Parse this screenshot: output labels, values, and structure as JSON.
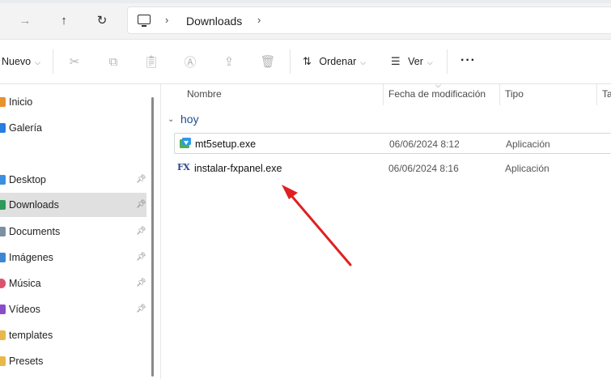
{
  "address_bar": {
    "location_label": "Downloads",
    "icons": {
      "forward": "arrow-right-icon",
      "up": "arrow-up-icon",
      "refresh": "refresh-icon",
      "pc": "monitor-icon"
    }
  },
  "toolbar": {
    "new_label": "Nuevo",
    "sort_label": "Ordenar",
    "view_label": "Ver",
    "more_label": "···",
    "icons": [
      "cut-icon",
      "copy-icon",
      "paste-icon",
      "rename-icon",
      "share-icon",
      "delete-icon"
    ]
  },
  "sidebar": {
    "items": [
      {
        "label": "Inicio",
        "icon": "home-icon",
        "color": "#e8912d",
        "pinned": false
      },
      {
        "label": "Galería",
        "icon": "gallery-icon",
        "color": "#2a7de1",
        "pinned": false
      },
      {
        "label": "Desktop",
        "icon": "desktop-folder-icon",
        "color": "#3d8fe0",
        "pinned": true
      },
      {
        "label": "Downloads",
        "icon": "downloads-folder-icon",
        "color": "#2d9a5a",
        "pinned": true,
        "selected": true
      },
      {
        "label": "Documents",
        "icon": "documents-folder-icon",
        "color": "#7d8fa3",
        "pinned": true
      },
      {
        "label": "Imágenes",
        "icon": "pictures-folder-icon",
        "color": "#3b87d6",
        "pinned": true
      },
      {
        "label": "Música",
        "icon": "music-folder-icon",
        "color": "#d9536d",
        "pinned": true
      },
      {
        "label": "Vídeos",
        "icon": "videos-folder-icon",
        "color": "#8c4cc9",
        "pinned": true
      },
      {
        "label": "templates",
        "icon": "folder-icon",
        "color": "#e8b84a",
        "pinned": false
      },
      {
        "label": "Presets",
        "icon": "folder-icon",
        "color": "#e8b84a",
        "pinned": false
      }
    ]
  },
  "columns": {
    "name": "Nombre",
    "date": "Fecha de modificación",
    "type": "Tipo",
    "size": "Ta"
  },
  "group": {
    "label": "hoy"
  },
  "files": [
    {
      "name": "mt5setup.exe",
      "date": "06/06/2024 8:12",
      "type": "Aplicación",
      "icon": "mt5-installer-icon"
    },
    {
      "name": "instalar-fxpanel.exe",
      "date": "06/06/2024 8:16",
      "type": "Aplicación",
      "icon": "fx-app-icon",
      "icon_text": "FX"
    }
  ],
  "annotation": {
    "color": "#e02020"
  }
}
